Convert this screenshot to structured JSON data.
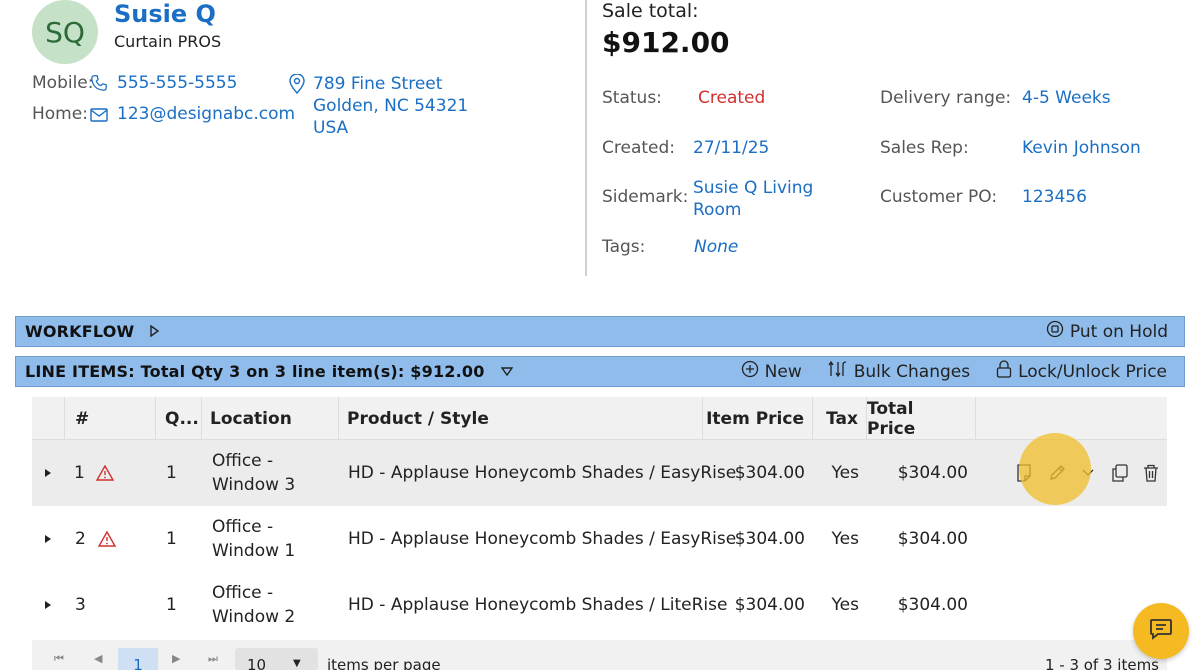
{
  "customer": {
    "initials": "SQ",
    "name": "Susie Q",
    "company": "Curtain PROS",
    "mobile_label": "Mobile:",
    "mobile": "555-555-5555",
    "home_label": "Home:",
    "email": "123@designabc.com",
    "address_line1": "789 Fine Street",
    "address_line2": "Golden, NC 54321",
    "address_line3": "USA"
  },
  "sale": {
    "total_label": "Sale total:",
    "total": "$912.00",
    "status_label": "Status:",
    "status": "Created",
    "created_label": "Created:",
    "created": "27/11/25",
    "sidemark_label": "Sidemark:",
    "sidemark_line1": "Susie Q Living",
    "sidemark_line2": "Room",
    "tags_label": "Tags:",
    "tags": "None",
    "delivery_label": "Delivery range:",
    "delivery": "4-5 Weeks",
    "rep_label": "Sales Rep:",
    "rep": "Kevin Johnson",
    "po_label": "Customer PO:",
    "po": "123456"
  },
  "workflow": {
    "title": "WORKFLOW",
    "hold_label": "Put on Hold"
  },
  "line_items": {
    "title": "LINE ITEMS: Total Qty 3 on 3 line item(s): $912.00",
    "new_label": "New",
    "bulk_label": "Bulk Changes",
    "lock_label": "Lock/Unlock Price"
  },
  "table": {
    "headers": [
      "#",
      "Q...",
      "Location",
      "Product / Style",
      "Item Price",
      "Tax",
      "Total Price"
    ],
    "rows": [
      {
        "num": "1",
        "qty": "1",
        "loc1": "Office -",
        "loc2": "Window 3",
        "product": "HD - Applause Honeycomb Shades / EasyRise",
        "price": "$304.00",
        "tax": "Yes",
        "total": "$304.00",
        "warning": true
      },
      {
        "num": "2",
        "qty": "1",
        "loc1": "Office -",
        "loc2": "Window 1",
        "product": "HD - Applause Honeycomb Shades / EasyRise",
        "price": "$304.00",
        "tax": "Yes",
        "total": "$304.00",
        "warning": true
      },
      {
        "num": "3",
        "qty": "1",
        "loc1": "Office -",
        "loc2": "Window 2",
        "product": "HD - Applause Honeycomb Shades / LiteRise",
        "price": "$304.00",
        "tax": "Yes",
        "total": "$304.00",
        "warning": false
      }
    ]
  },
  "pager": {
    "page": "1",
    "per_page": "10",
    "per_page_label": "items per page",
    "summary": "1 - 3 of 3 items"
  },
  "colors": {
    "accent": "#1a6fc4",
    "bar": "#8fbcea",
    "status": "#d0312d",
    "highlight": "#f0be28"
  }
}
